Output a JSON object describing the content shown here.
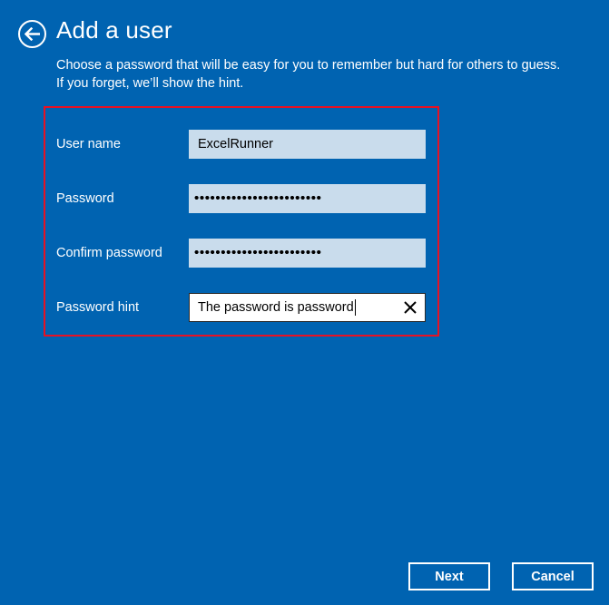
{
  "header": {
    "title": "Add a user",
    "back_icon": "back-arrow-icon"
  },
  "description": "Choose a password that will be easy for you to remember but hard for others to guess. If you forget, we’ll show the hint.",
  "form": {
    "fields": [
      {
        "label": "User name",
        "value": "ExcelRunner",
        "type": "text"
      },
      {
        "label": "Password",
        "value": "••••••••••••••••••••••••",
        "type": "password"
      },
      {
        "label": "Confirm password",
        "value": "••••••••••••••••••••••••",
        "type": "password"
      },
      {
        "label": "Password hint",
        "value": "The password is password",
        "type": "text",
        "focused": true,
        "clear_icon": "close-icon"
      }
    ],
    "highlight_color": "#e81123"
  },
  "buttons": {
    "next": "Next",
    "cancel": "Cancel"
  },
  "colors": {
    "background": "#0063b1",
    "field_background": "#c9dcec",
    "text": "#ffffff"
  }
}
